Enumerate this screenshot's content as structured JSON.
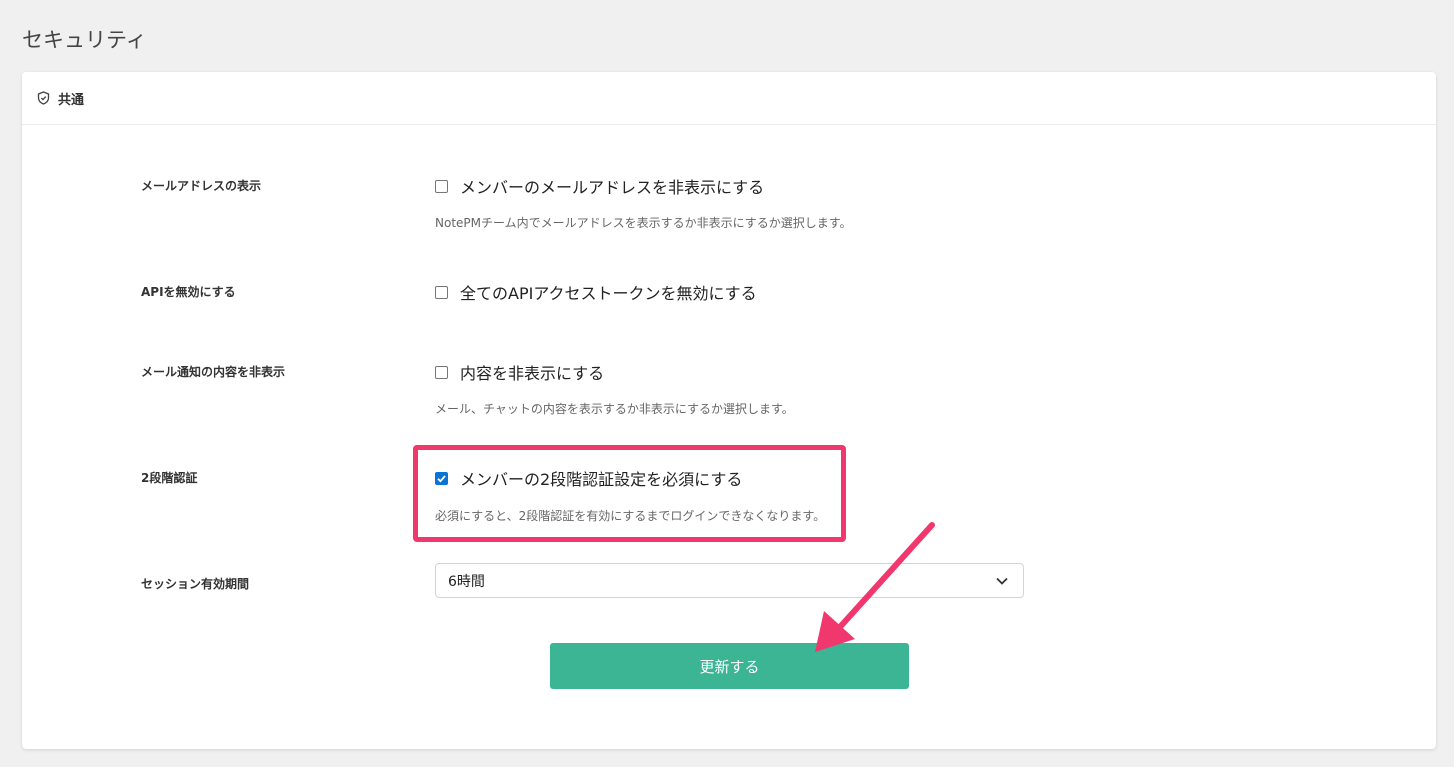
{
  "page": {
    "title": "セキュリティ"
  },
  "card": {
    "header_title": "共通"
  },
  "settings": {
    "email_display": {
      "label": "メールアドレスの表示",
      "checkbox_label": "メンバーのメールアドレスを非表示にする",
      "checked": false,
      "help": "NotePMチーム内でメールアドレスを表示するか非表示にするか選択します。"
    },
    "api_disable": {
      "label": "APIを無効にする",
      "checkbox_label": "全てのAPIアクセストークンを無効にする",
      "checked": false
    },
    "mail_notification": {
      "label": "メール通知の内容を非表示",
      "checkbox_label": "内容を非表示にする",
      "checked": false,
      "help": "メール、チャットの内容を表示するか非表示にするか選択します。"
    },
    "two_factor": {
      "label": "2段階認証",
      "checkbox_label": "メンバーの2段階認証設定を必須にする",
      "checked": true,
      "help": "必須にすると、2段階認証を有効にするまでログインできなくなります。"
    },
    "session": {
      "label": "セッション有効期間",
      "selected_value": "6時間"
    }
  },
  "submit_label": "更新する",
  "colors": {
    "accent_green": "#3cb595",
    "highlight_pink": "#f0386e",
    "checkbox_blue": "#0a74d4"
  }
}
